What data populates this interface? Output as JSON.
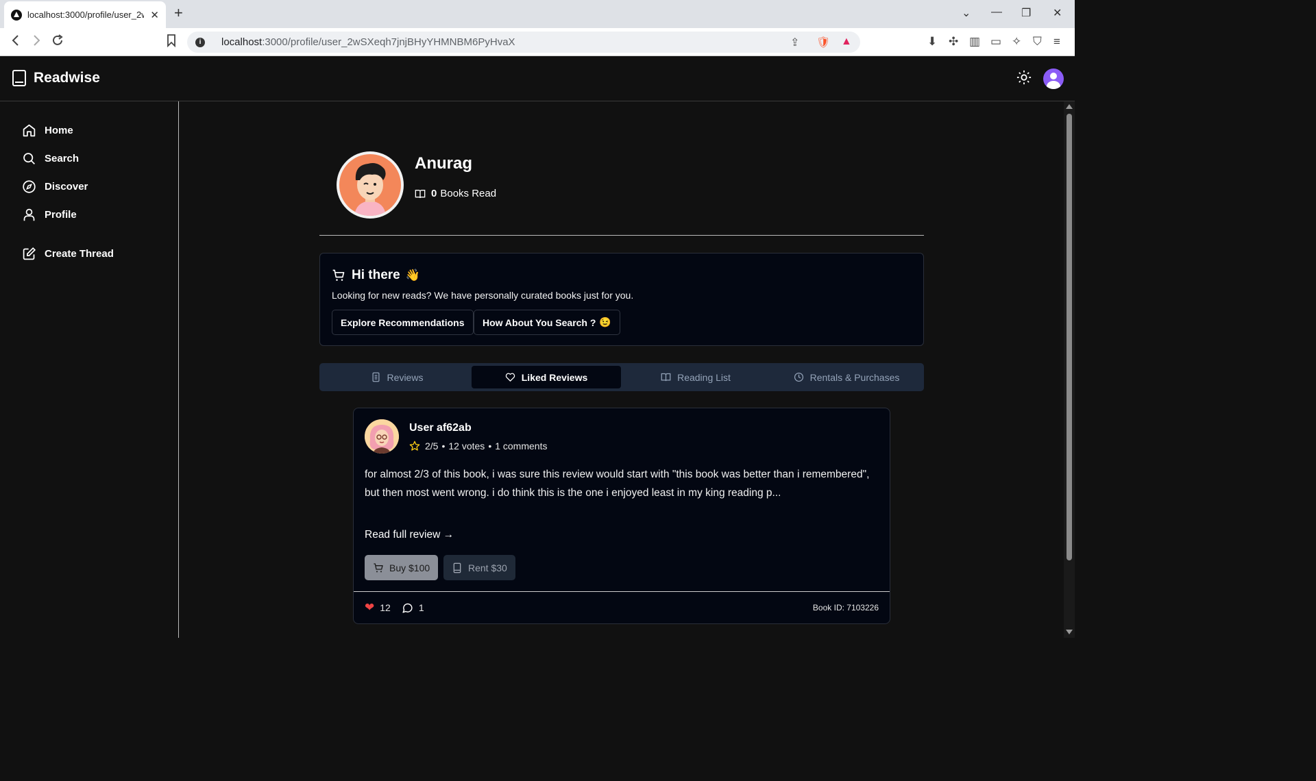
{
  "browser": {
    "tab_title": "localhost:3000/profile/user_2wS",
    "url_host": "localhost",
    "url_path": ":3000/profile/user_2wSXeqh7jnjBHyYHMNBM6PyHvaX"
  },
  "app": {
    "name": "Readwise"
  },
  "sidebar": {
    "items": [
      {
        "label": "Home",
        "icon": "home-icon"
      },
      {
        "label": "Search",
        "icon": "search-icon"
      },
      {
        "label": "Discover",
        "icon": "compass-icon"
      },
      {
        "label": "Profile",
        "icon": "user-icon"
      },
      {
        "label": "Create Thread",
        "icon": "edit-icon"
      }
    ]
  },
  "profile": {
    "name": "Anurag",
    "books_read_count": "0",
    "books_read_label": "Books Read"
  },
  "promo": {
    "title": "Hi there",
    "emoji": "👋",
    "subtitle": "Looking for new reads? We have personally curated books just for you.",
    "btn_explore": "Explore Recommendations",
    "btn_search": "How About You Search ?",
    "btn_search_emoji": "😉"
  },
  "tabs": [
    {
      "label": "Reviews",
      "icon": "document-icon",
      "active": false
    },
    {
      "label": "Liked Reviews",
      "icon": "heart-icon",
      "active": true
    },
    {
      "label": "Reading List",
      "icon": "book-open-icon",
      "active": false
    },
    {
      "label": "Rentals & Purchases",
      "icon": "clock-icon",
      "active": false
    }
  ],
  "review": {
    "user": "User af62ab",
    "rating": "2/5",
    "votes": "12 votes",
    "comments": "1 comments",
    "text": "for almost 2/3 of this book, i was sure this review would start with \"this book was better than i remembered\", but then most went wrong. i do think this is the one i enjoyed least in my king reading p...",
    "read_more": "Read full review →",
    "buy_label": "Buy $100",
    "rent_label": "Rent $30",
    "likes": "12",
    "comment_count": "1",
    "book_id": "Book ID: 7103226"
  },
  "colors": {
    "accent_purple": "#8b5cf6",
    "avatar_orange": "#f3875a",
    "heart_red": "#ef4444",
    "star_yellow": "#facc15"
  }
}
